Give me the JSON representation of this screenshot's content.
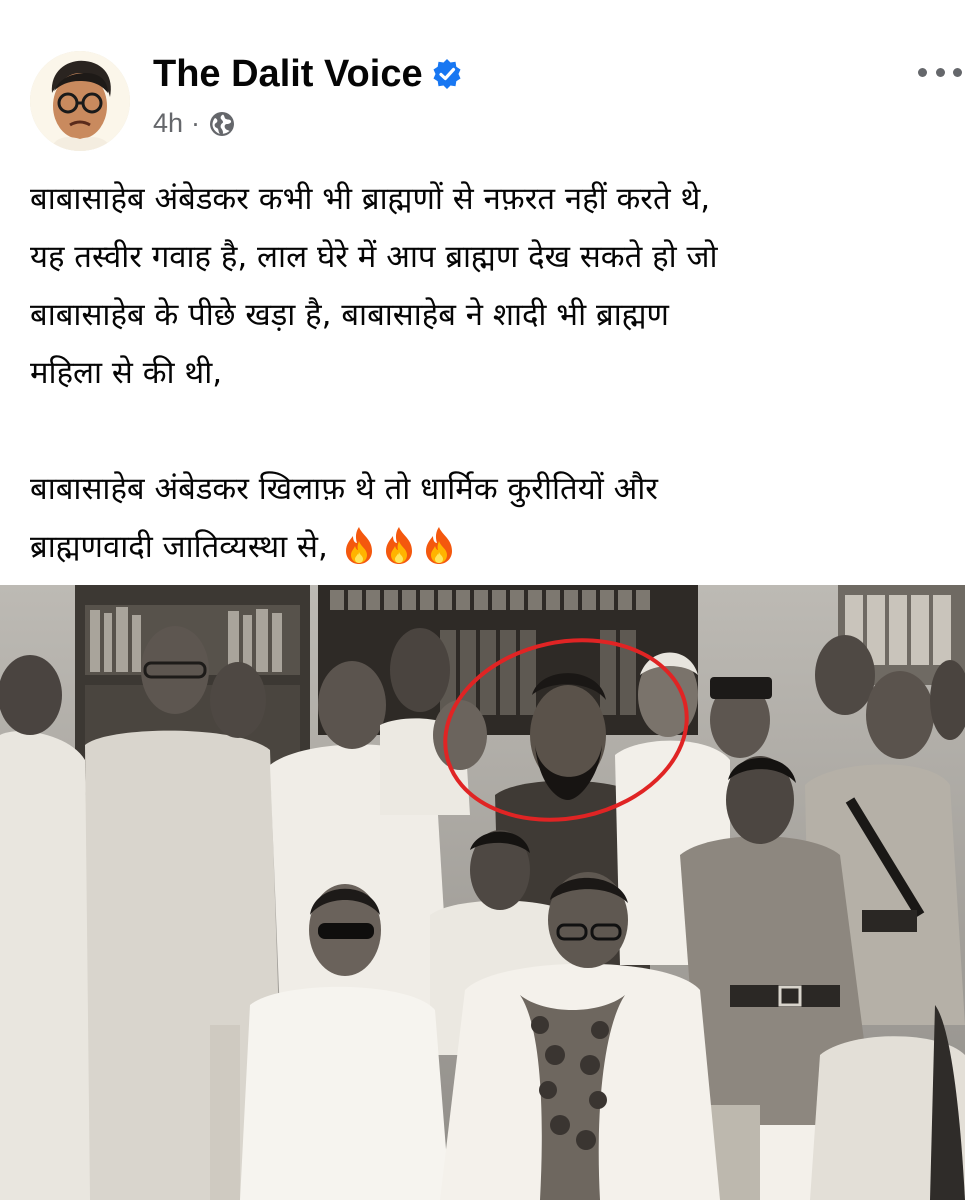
{
  "post": {
    "page_name": "The Dalit Voice",
    "verified_icon": "verified-badge-icon",
    "time": "4h",
    "separator": "·",
    "privacy_icon": "globe-icon",
    "more_icon": "more-options-icon",
    "text_lines": [
      "बाबासाहेब अंबेडकर कभी भी ब्राह्मणों से नफ़रत नहीं करते थे,",
      "यह तस्वीर गवाह है, लाल घेरे में आप ब्राह्मण देख सकते हो जो",
      "बाबासाहेब के पीछे खड़ा है, बाबासाहेब ने शादी भी ब्राह्मण",
      "महिला से की थी,",
      "",
      "बाबासाहेब अंबेडकर खिलाफ़ थे तो धार्मिक कुरीतियों और",
      "ब्राह्मणवादी जातिव्यस्था से,"
    ],
    "emoji_icon": "fire-emoji-icon",
    "emoji_count": 3,
    "colors": {
      "verified": "#1877f2",
      "meta": "#65676b",
      "highlight_circle": "#e02424"
    }
  }
}
